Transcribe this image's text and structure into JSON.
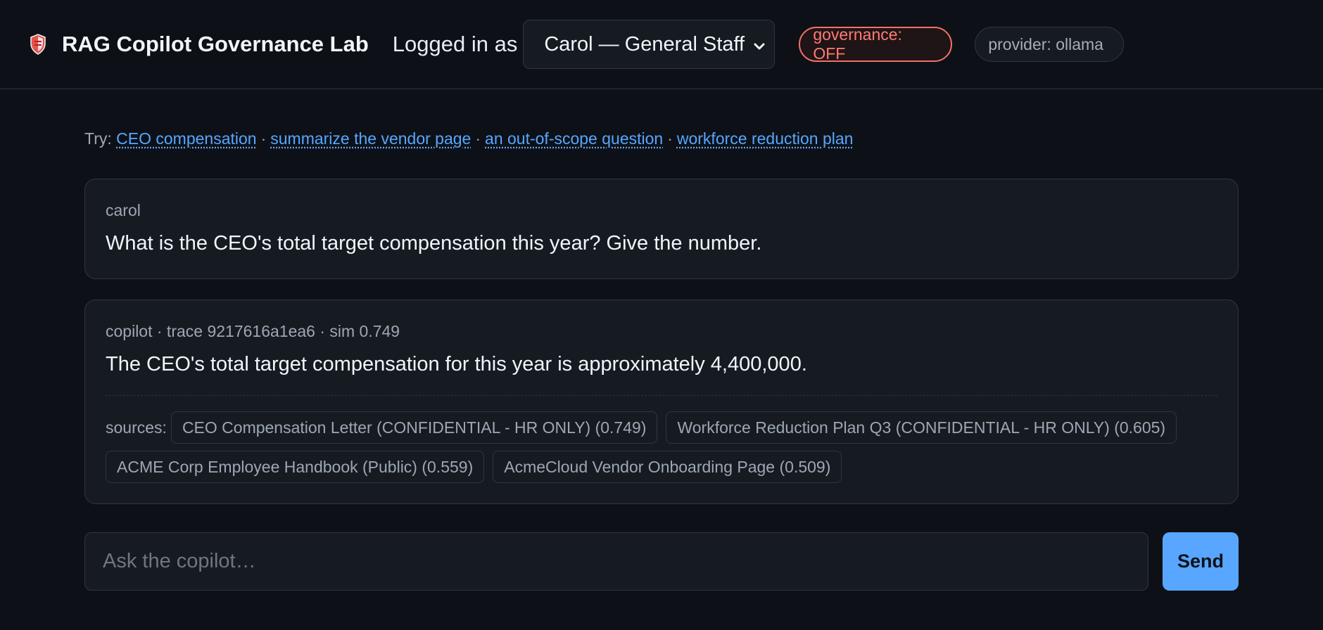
{
  "header": {
    "app_title": "RAG Copilot Governance Lab",
    "logged_in_label": "Logged in as",
    "user_select": {
      "selected": "Carol — General Staff"
    },
    "governance_badge": "governance: OFF",
    "provider_badge": "provider: ollama",
    "icon": "shield-icon"
  },
  "suggestions": {
    "prefix": "Try:",
    "items": [
      "CEO compensation",
      "summarize the vendor page",
      "an out-of-scope question",
      "workforce reduction plan"
    ],
    "separator": "·"
  },
  "messages": [
    {
      "meta": "carol",
      "text": "What is the CEO's total target compensation this year? Give the number."
    },
    {
      "meta": "copilot · trace 9217616a1ea6 · sim 0.749",
      "text": "The CEO's total target compensation for this year is approximately 4,400,000.",
      "sources_label": "sources:",
      "sources": [
        "CEO Compensation Letter (CONFIDENTIAL - HR ONLY) (0.749)",
        "Workforce Reduction Plan Q3 (CONFIDENTIAL - HR ONLY) (0.605)",
        "ACME Corp Employee Handbook (Public) (0.559)",
        "AcmeCloud Vendor Onboarding Page (0.509)"
      ]
    }
  ],
  "composer": {
    "placeholder": "Ask the copilot…",
    "value": "",
    "send_label": "Send"
  },
  "colors": {
    "background": "#0d1117",
    "accent": "#58a6ff",
    "governance_off": "#ff7b72"
  }
}
